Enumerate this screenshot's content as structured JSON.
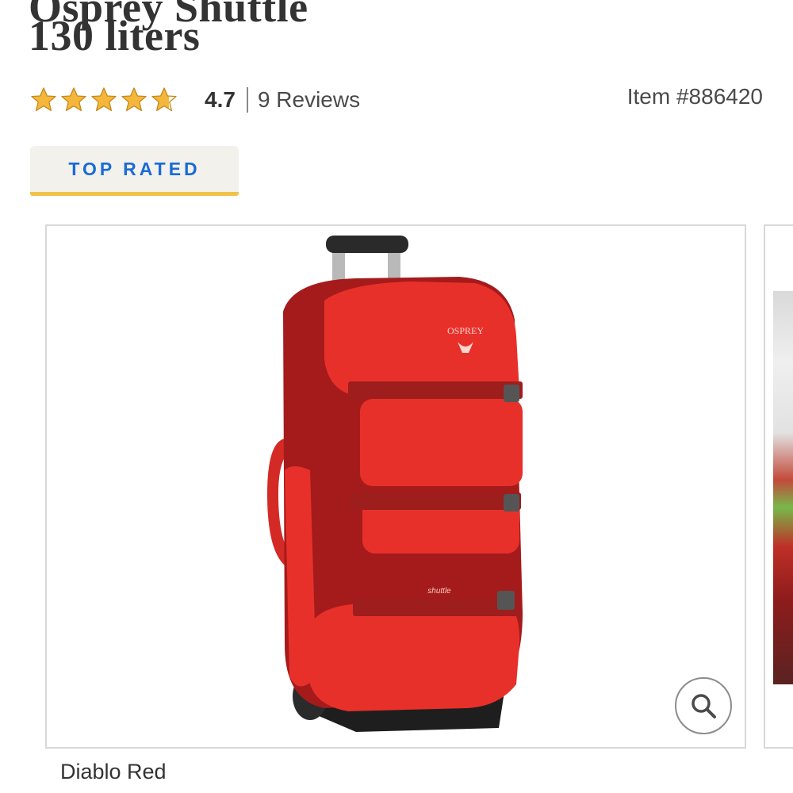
{
  "product": {
    "title_cut": "Osprey Shuttle",
    "title": "130 liters",
    "rating": "4.7",
    "rating_fraction": 0.94,
    "star_count": 5,
    "reviews": "9 Reviews",
    "item_number": "Item #886420",
    "badge": "TOP RATED",
    "color_name": "Diablo Red"
  },
  "bag_print": {
    "brand": "OSPREY",
    "model": "shuttle"
  },
  "icons": {
    "star": "star-icon",
    "zoom": "magnifier-icon"
  },
  "colors": {
    "star": "#f4b73c",
    "badge_text": "#1a6bd6",
    "badge_accent": "#f1c24a",
    "badge_bg": "#f2f1ec",
    "bag_red": "#e8302a",
    "bag_dark_red": "#a51b1b"
  }
}
